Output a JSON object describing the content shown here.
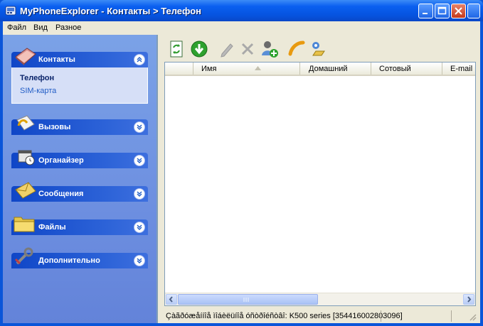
{
  "window": {
    "title": "MyPhoneExplorer  -  Контакты > Телефон"
  },
  "menu": {
    "items": [
      "Файл",
      "Вид",
      "Разное"
    ]
  },
  "sidebar": {
    "groups": [
      {
        "label": "Контакты",
        "expanded": true,
        "icon": "contacts-book-icon",
        "items": [
          "Телефон",
          "SIM-карта"
        ],
        "selected": "Телефон"
      },
      {
        "label": "Вызовы",
        "expanded": false,
        "icon": "calls-icon"
      },
      {
        "label": "Органайзер",
        "expanded": false,
        "icon": "organizer-icon"
      },
      {
        "label": "Сообщения",
        "expanded": false,
        "icon": "messages-envelope-icon"
      },
      {
        "label": "Файлы",
        "expanded": false,
        "icon": "files-folder-icon"
      },
      {
        "label": "Дополнительно",
        "expanded": false,
        "icon": "tools-wrench-icon"
      }
    ]
  },
  "toolbar": {
    "buttons": [
      {
        "name": "refresh-icon",
        "enabled": true
      },
      {
        "name": "download-icon",
        "enabled": true
      },
      {
        "name": "edit-pencil-icon",
        "enabled": false
      },
      {
        "name": "delete-x-icon",
        "enabled": false
      },
      {
        "name": "add-contact-icon",
        "enabled": true
      },
      {
        "name": "call-phone-icon",
        "enabled": true
      },
      {
        "name": "contact-group-icon",
        "enabled": true
      }
    ]
  },
  "list": {
    "columns": [
      "",
      "Имя",
      "Домашний",
      "Сотовый",
      "E-mail"
    ],
    "sort_column": "Имя",
    "sort_direction": "ascending",
    "rows": []
  },
  "statusbar": {
    "text": "Çàãðóæåííîå ìîáèëüíîå óñòðîéñòâî: K500 series [354416002803096]"
  },
  "colors": {
    "titlebar": "#0a5ff0",
    "sidebar": "#7ba2e7",
    "group_header": "#0f46c7",
    "link": "#215dc6"
  }
}
